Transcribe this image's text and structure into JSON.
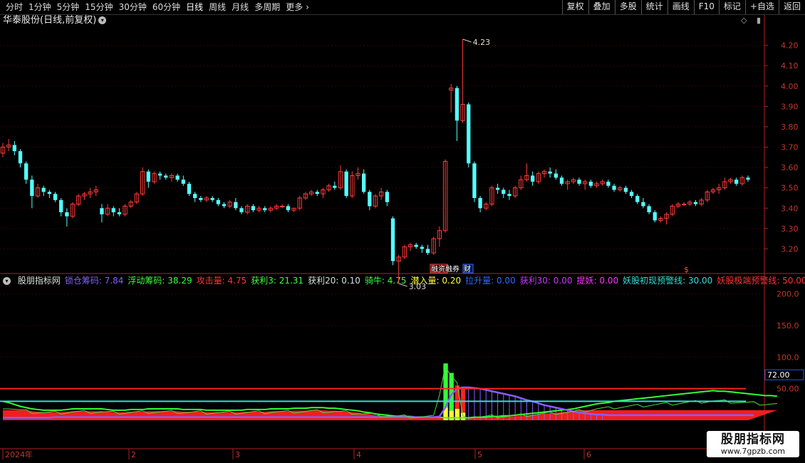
{
  "toolbar": {
    "periods": [
      "分时",
      "1分钟",
      "5分钟",
      "15分钟",
      "30分钟",
      "60分钟",
      "日线",
      "周线",
      "月线",
      "多周期",
      "更多"
    ],
    "active_period": "日线",
    "more_arrow": "›",
    "right_buttons": [
      "复权",
      "叠加",
      "多股",
      "统计",
      "画线",
      "F10",
      "标记",
      "+自选",
      "返回"
    ]
  },
  "stock": {
    "title": "华泰股份(日线,前复权)",
    "high_label": "4.23",
    "low_label": "3.03",
    "marker_1": "融资融券",
    "marker_2": "财",
    "marker_3": "$"
  },
  "price_axis": [
    "4.20",
    "4.10",
    "4.00",
    "3.90",
    "3.80",
    "3.70",
    "3.60",
    "3.50",
    "3.40",
    "3.30",
    "3.20"
  ],
  "indicator": {
    "name": "股朋指标网",
    "items": [
      {
        "label": "锁仓筹码: 7.84",
        "color": "#8a5cff"
      },
      {
        "label": "浮动筹码: 38.29",
        "color": "#3cff3c"
      },
      {
        "label": "攻击量: 4.75",
        "color": "#ff3333"
      },
      {
        "label": "获利3: 21.31",
        "color": "#3cff3c"
      },
      {
        "label": "获利20: 0.10",
        "color": "#dcdcdc"
      },
      {
        "label": "骑牛: 4.75",
        "color": "#3cff3c"
      },
      {
        "label": "潜入量: 0.20",
        "color": "#ffff33"
      },
      {
        "label": "拉升量: 0.00",
        "color": "#3366ff"
      },
      {
        "label": "获利30: 0.00",
        "color": "#cc33ff"
      },
      {
        "label": "提妖: 0.00",
        "color": "#ff33ff"
      },
      {
        "label": "妖股初现预警线: 30.00",
        "color": "#33dddd"
      },
      {
        "label": "妖股极端预警线: 50.00",
        "color": "#ff3333"
      }
    ],
    "axis": [
      "200.0",
      "150.0",
      "100.0",
      "50.00"
    ],
    "current_value": "72.00"
  },
  "time_axis": [
    "2024年",
    "2",
    "3",
    "4",
    "5",
    "6"
  ],
  "watermark": {
    "title": "股朋指标网",
    "url": "www.7gpzb.com"
  },
  "colors": {
    "up": "#ff3b3b",
    "down": "#54ffff",
    "axis": "#b22222",
    "grid": "#3a0000"
  },
  "chart_data": {
    "type": "candlestick",
    "ohlc": [
      [
        3.67,
        3.72,
        3.65,
        3.7
      ],
      [
        3.7,
        3.74,
        3.68,
        3.71
      ],
      [
        3.71,
        3.73,
        3.66,
        3.68
      ],
      [
        3.68,
        3.69,
        3.6,
        3.62
      ],
      [
        3.62,
        3.63,
        3.52,
        3.54
      ],
      [
        3.54,
        3.56,
        3.4,
        3.46
      ],
      [
        3.46,
        3.52,
        3.45,
        3.5
      ],
      [
        3.5,
        3.51,
        3.46,
        3.48
      ],
      [
        3.48,
        3.49,
        3.45,
        3.47
      ],
      [
        3.47,
        3.48,
        3.43,
        3.44
      ],
      [
        3.44,
        3.45,
        3.36,
        3.38
      ],
      [
        3.38,
        3.4,
        3.31,
        3.36
      ],
      [
        3.36,
        3.43,
        3.35,
        3.42
      ],
      [
        3.42,
        3.47,
        3.41,
        3.46
      ],
      [
        3.46,
        3.48,
        3.44,
        3.47
      ],
      [
        3.47,
        3.5,
        3.45,
        3.48
      ],
      [
        3.48,
        3.51,
        3.46,
        3.49
      ],
      [
        3.4,
        3.42,
        3.33,
        3.37
      ],
      [
        3.37,
        3.42,
        3.36,
        3.4
      ],
      [
        3.4,
        3.41,
        3.36,
        3.38
      ],
      [
        3.38,
        3.4,
        3.36,
        3.37
      ],
      [
        3.37,
        3.42,
        3.36,
        3.41
      ],
      [
        3.41,
        3.44,
        3.4,
        3.43
      ],
      [
        3.43,
        3.48,
        3.42,
        3.47
      ],
      [
        3.47,
        3.6,
        3.46,
        3.58
      ],
      [
        3.58,
        3.59,
        3.5,
        3.53
      ],
      [
        3.53,
        3.58,
        3.52,
        3.57
      ],
      [
        3.57,
        3.58,
        3.54,
        3.56
      ],
      [
        3.56,
        3.57,
        3.54,
        3.55
      ],
      [
        3.55,
        3.57,
        3.53,
        3.56
      ],
      [
        3.56,
        3.57,
        3.53,
        3.54
      ],
      [
        3.54,
        3.56,
        3.51,
        3.52
      ],
      [
        3.52,
        3.53,
        3.46,
        3.47
      ],
      [
        3.47,
        3.48,
        3.43,
        3.45
      ],
      [
        3.45,
        3.46,
        3.43,
        3.44
      ],
      [
        3.44,
        3.46,
        3.43,
        3.45
      ],
      [
        3.45,
        3.46,
        3.43,
        3.44
      ],
      [
        3.44,
        3.45,
        3.41,
        3.42
      ],
      [
        3.42,
        3.43,
        3.4,
        3.41
      ],
      [
        3.41,
        3.44,
        3.4,
        3.43
      ],
      [
        3.43,
        3.45,
        3.39,
        3.4
      ],
      [
        3.4,
        3.41,
        3.37,
        3.38
      ],
      [
        3.38,
        3.42,
        3.37,
        3.41
      ],
      [
        3.41,
        3.42,
        3.38,
        3.39
      ],
      [
        3.39,
        3.41,
        3.38,
        3.4
      ],
      [
        3.4,
        3.41,
        3.38,
        3.39
      ],
      [
        3.39,
        3.41,
        3.38,
        3.4
      ],
      [
        3.4,
        3.42,
        3.39,
        3.41
      ],
      [
        3.41,
        3.42,
        3.4,
        3.41
      ],
      [
        3.41,
        3.42,
        3.38,
        3.39
      ],
      [
        3.39,
        3.4,
        3.38,
        3.4
      ],
      [
        3.4,
        3.46,
        3.39,
        3.45
      ],
      [
        3.45,
        3.48,
        3.44,
        3.47
      ],
      [
        3.47,
        3.49,
        3.46,
        3.48
      ],
      [
        3.48,
        3.49,
        3.46,
        3.47
      ],
      [
        3.47,
        3.5,
        3.45,
        3.49
      ],
      [
        3.49,
        3.52,
        3.48,
        3.51
      ],
      [
        3.51,
        3.53,
        3.49,
        3.5
      ],
      [
        3.5,
        3.61,
        3.49,
        3.58
      ],
      [
        3.58,
        3.59,
        3.45,
        3.46
      ],
      [
        3.46,
        3.58,
        3.45,
        3.56
      ],
      [
        3.56,
        3.6,
        3.54,
        3.57
      ],
      [
        3.57,
        3.59,
        3.47,
        3.48
      ],
      [
        3.48,
        3.49,
        3.39,
        3.41
      ],
      [
        3.41,
        3.47,
        3.4,
        3.46
      ],
      [
        3.46,
        3.5,
        3.44,
        3.48
      ],
      [
        3.48,
        3.49,
        3.41,
        3.43
      ],
      [
        3.35,
        3.36,
        3.12,
        3.14
      ],
      [
        3.14,
        3.17,
        3.03,
        3.16
      ],
      [
        3.16,
        3.22,
        3.15,
        3.21
      ],
      [
        3.21,
        3.23,
        3.19,
        3.22
      ],
      [
        3.22,
        3.23,
        3.2,
        3.21
      ],
      [
        3.21,
        3.22,
        3.18,
        3.2
      ],
      [
        3.2,
        3.22,
        3.17,
        3.18
      ],
      [
        3.18,
        3.26,
        3.17,
        3.25
      ],
      [
        3.25,
        3.31,
        3.21,
        3.29
      ],
      [
        3.29,
        3.64,
        3.28,
        3.63
      ],
      [
        3.98,
        4.01,
        3.87,
        3.99
      ],
      [
        3.99,
        4.0,
        3.73,
        3.83
      ],
      [
        3.83,
        4.23,
        3.82,
        3.91
      ],
      [
        3.91,
        3.92,
        3.6,
        3.62
      ],
      [
        3.62,
        3.63,
        3.43,
        3.45
      ],
      [
        3.45,
        3.46,
        3.38,
        3.4
      ],
      [
        3.4,
        3.43,
        3.39,
        3.42
      ],
      [
        3.42,
        3.51,
        3.41,
        3.5
      ],
      [
        3.5,
        3.52,
        3.47,
        3.49
      ],
      [
        3.49,
        3.5,
        3.45,
        3.47
      ],
      [
        3.47,
        3.49,
        3.44,
        3.46
      ],
      [
        3.46,
        3.51,
        3.45,
        3.5
      ],
      [
        3.5,
        3.56,
        3.49,
        3.54
      ],
      [
        3.54,
        3.62,
        3.53,
        3.56
      ],
      [
        3.56,
        3.58,
        3.51,
        3.53
      ],
      [
        3.53,
        3.58,
        3.52,
        3.57
      ],
      [
        3.57,
        3.59,
        3.55,
        3.58
      ],
      [
        3.58,
        3.6,
        3.55,
        3.57
      ],
      [
        3.57,
        3.59,
        3.54,
        3.55
      ],
      [
        3.55,
        3.56,
        3.51,
        3.52
      ],
      [
        3.52,
        3.54,
        3.49,
        3.53
      ],
      [
        3.53,
        3.55,
        3.52,
        3.54
      ],
      [
        3.54,
        3.55,
        3.51,
        3.52
      ],
      [
        3.52,
        3.54,
        3.49,
        3.53
      ],
      [
        3.53,
        3.54,
        3.5,
        3.51
      ],
      [
        3.51,
        3.53,
        3.5,
        3.52
      ],
      [
        3.52,
        3.54,
        3.51,
        3.53
      ],
      [
        3.53,
        3.54,
        3.5,
        3.51
      ],
      [
        3.51,
        3.52,
        3.48,
        3.49
      ],
      [
        3.49,
        3.51,
        3.48,
        3.5
      ],
      [
        3.5,
        3.51,
        3.47,
        3.48
      ],
      [
        3.48,
        3.49,
        3.45,
        3.46
      ],
      [
        3.46,
        3.47,
        3.42,
        3.43
      ],
      [
        3.43,
        3.45,
        3.4,
        3.41
      ],
      [
        3.41,
        3.42,
        3.37,
        3.38
      ],
      [
        3.38,
        3.39,
        3.33,
        3.34
      ],
      [
        3.34,
        3.36,
        3.33,
        3.35
      ],
      [
        3.35,
        3.38,
        3.32,
        3.37
      ],
      [
        3.37,
        3.42,
        3.36,
        3.41
      ],
      [
        3.41,
        3.43,
        3.4,
        3.42
      ],
      [
        3.42,
        3.43,
        3.41,
        3.42
      ],
      [
        3.42,
        3.44,
        3.41,
        3.43
      ],
      [
        3.43,
        3.44,
        3.41,
        3.42
      ],
      [
        3.42,
        3.45,
        3.41,
        3.44
      ],
      [
        3.44,
        3.49,
        3.43,
        3.48
      ],
      [
        3.48,
        3.5,
        3.47,
        3.49
      ],
      [
        3.49,
        3.52,
        3.47,
        3.5
      ],
      [
        3.5,
        3.55,
        3.49,
        3.53
      ],
      [
        3.53,
        3.55,
        3.52,
        3.54
      ],
      [
        3.54,
        3.55,
        3.51,
        3.52
      ],
      [
        3.52,
        3.56,
        3.51,
        3.55
      ],
      [
        3.55,
        3.56,
        3.53,
        3.54
      ]
    ],
    "ylim": [
      3.1,
      4.3
    ],
    "indicator_ylim": [
      0,
      220
    ],
    "warning_lines": [
      30,
      50
    ],
    "current_value": 72,
    "lock_chip_line": [
      4,
      4,
      4,
      4,
      4,
      4,
      4,
      4,
      4,
      5,
      5,
      5,
      5,
      5,
      5,
      5,
      5,
      5,
      5,
      5,
      5,
      5,
      5,
      5,
      5,
      5,
      5,
      5,
      5,
      5,
      5,
      5,
      5,
      5,
      5,
      5,
      5,
      5,
      5,
      5,
      5,
      5,
      5,
      5,
      5,
      5,
      5,
      5,
      5,
      5,
      5,
      5,
      5,
      5,
      5,
      5,
      5,
      5,
      5,
      5,
      5,
      5,
      5,
      5,
      5,
      5,
      5,
      5,
      5,
      5,
      5,
      5,
      5,
      5,
      5,
      6,
      20,
      40,
      50,
      52,
      52,
      51,
      50,
      48,
      46,
      44,
      42,
      40,
      38,
      35,
      32,
      30,
      27,
      24,
      22,
      20,
      18,
      16,
      14,
      12,
      11,
      10,
      9,
      9,
      8,
      8,
      8,
      8,
      8,
      8,
      8,
      8,
      8,
      8,
      8,
      8,
      8,
      8,
      8,
      8,
      8,
      8,
      8,
      8,
      8,
      8,
      8,
      8,
      8,
      8
    ],
    "float_chip_line": [
      30,
      28,
      25,
      22,
      20,
      18,
      17,
      16,
      16,
      16,
      16,
      17,
      18,
      18,
      18,
      18,
      18,
      18,
      17,
      16,
      16,
      16,
      17,
      17,
      17,
      18,
      18,
      18,
      18,
      18,
      18,
      17,
      17,
      17,
      17,
      16,
      16,
      16,
      16,
      16,
      16,
      16,
      17,
      17,
      17,
      17,
      18,
      18,
      18,
      18,
      19,
      19,
      19,
      20,
      20,
      20,
      19,
      19,
      18,
      17,
      16,
      15,
      13,
      12,
      10,
      9,
      8,
      7,
      6,
      6,
      6,
      5,
      5,
      5,
      5,
      5,
      4,
      4,
      4,
      4,
      4,
      5,
      5,
      5,
      6,
      6,
      7,
      7,
      8,
      9,
      10,
      11,
      12,
      13,
      14,
      15,
      16,
      17,
      18,
      20,
      22,
      24,
      26,
      27,
      28,
      30,
      31,
      32,
      33,
      34,
      35,
      36,
      37,
      38,
      39,
      40,
      41,
      42,
      43,
      44,
      45,
      46,
      47,
      46,
      46,
      45,
      44,
      43,
      42,
      41,
      40,
      39,
      39,
      38
    ]
  }
}
